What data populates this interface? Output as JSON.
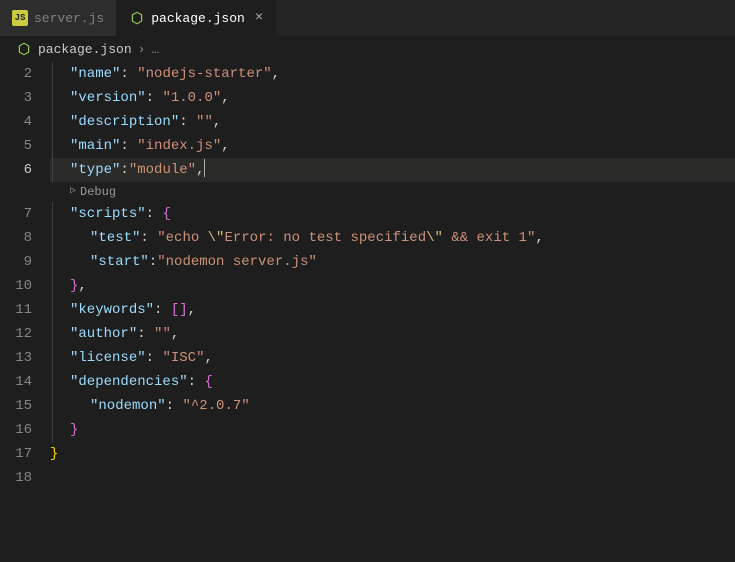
{
  "tabs": {
    "inactive": {
      "label": "server.js",
      "iconText": "JS"
    },
    "active": {
      "label": "package.json"
    }
  },
  "breadcrumb": {
    "file": "package.json",
    "chevron": "›",
    "ellipsis": "…"
  },
  "gutter": {
    "l2": "2",
    "l3": "3",
    "l4": "4",
    "l5": "5",
    "l6": "6",
    "l7": "7",
    "l8": "8",
    "l9": "9",
    "l10": "10",
    "l11": "11",
    "l12": "12",
    "l13": "13",
    "l14": "14",
    "l15": "15",
    "l16": "16",
    "l17": "17",
    "l18": "18"
  },
  "codelens": {
    "label": "Debug"
  },
  "tok": {
    "q": "\"",
    "colon": ":",
    "comma": ",",
    "sp": " ",
    "lbrace": "{",
    "rbrace": "}",
    "lbrack": "[",
    "rbrack": "]",
    "name_k": "name",
    "name_v": "nodejs-starter",
    "version_k": "version",
    "version_v": "1.0.0",
    "description_k": "description",
    "description_v": "",
    "main_k": "main",
    "main_v": "index.js",
    "type_k": "type",
    "type_v": "module",
    "scripts_k": "scripts",
    "test_k": "test",
    "test_v1": "echo ",
    "test_esc1": "\\\"",
    "test_v2": "Error: no test specified",
    "test_esc2": "\\\"",
    "test_v3": " && exit 1",
    "start_k": "start",
    "start_v": "nodemon server.js",
    "keywords_k": "keywords",
    "author_k": "author",
    "author_v": "",
    "license_k": "license",
    "license_v": "ISC",
    "dependencies_k": "dependencies",
    "nodemon_k": "nodemon",
    "nodemon_v": "^2.0.7"
  }
}
